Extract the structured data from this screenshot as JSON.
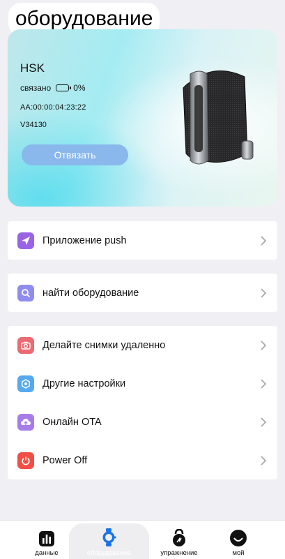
{
  "header": {
    "title": "оборудование"
  },
  "device": {
    "name": "HSK",
    "status": "связано",
    "battery": "0%",
    "mac": "AA:00:00:04:23:22",
    "version": "V34130",
    "unbind_label": "Отвязать"
  },
  "menu": {
    "group1": [
      {
        "label": "Приложение push",
        "icon": "send-icon",
        "color": "#9a63e6"
      }
    ],
    "group2": [
      {
        "label": "найти оборудование",
        "icon": "search-icon",
        "color": "#8f8cf0"
      }
    ],
    "group3": [
      {
        "label": "Делайте снимки удаленно",
        "icon": "camera-icon",
        "color": "#ec6a72"
      },
      {
        "label": "Другие настройки",
        "icon": "hexagon-settings-icon",
        "color": "#56a9ee"
      },
      {
        "label": "Онлайн OTA",
        "icon": "cloud-upload-icon",
        "color": "#a97be9"
      },
      {
        "label": "Power Off",
        "icon": "power-icon",
        "color": "#ef4f45"
      }
    ]
  },
  "tabbar": {
    "tabs": [
      {
        "label": "данные",
        "icon": "bar-chart-icon"
      },
      {
        "label": "оборудование",
        "icon": "watch-icon",
        "active": true
      },
      {
        "label": "упражнение",
        "icon": "kettlebell-icon"
      },
      {
        "label": "мой",
        "icon": "profile-smile-icon"
      }
    ]
  }
}
